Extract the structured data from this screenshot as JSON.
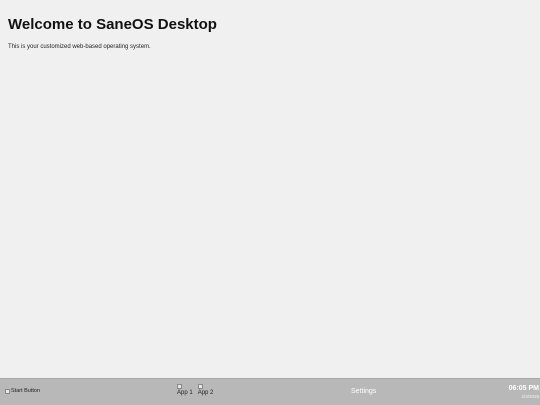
{
  "desktop": {
    "title": "Welcome to SaneOS Desktop",
    "subtitle": "This is your customized web-based operating system."
  },
  "taskbar": {
    "start_button_alt": "Start Button",
    "apps": [
      {
        "label": "App 1",
        "icon": "broken-image-icon"
      },
      {
        "label": "App 2",
        "icon": "broken-image-icon"
      }
    ],
    "settings_label": "Settings",
    "clock": {
      "time": "06:05 PM",
      "date": "2/3/2026"
    }
  },
  "colors": {
    "desktop_background": "#f0f0f0",
    "taskbar_background": "#b8b8b8",
    "taskbar_text": "#ffffff"
  }
}
